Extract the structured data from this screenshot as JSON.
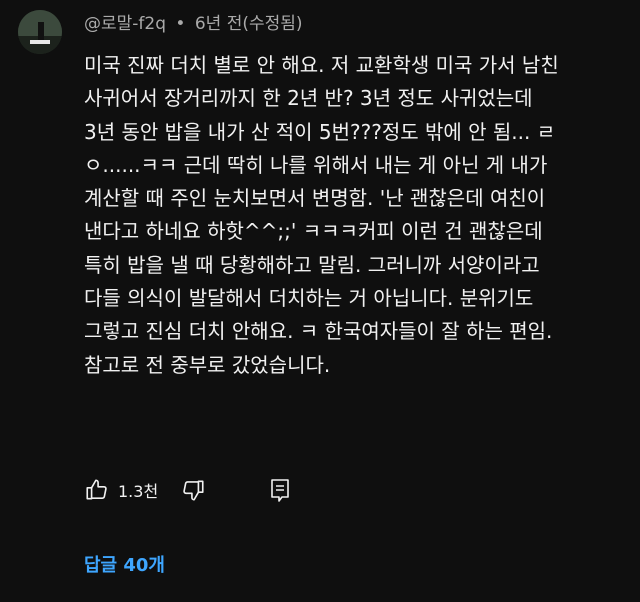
{
  "comment": {
    "author": "@로말-f2q",
    "separator": "•",
    "time": "6년 전(수정됨)",
    "lines": [
      "미국 진짜 더치 별로 안 해요. 저 교환학생 미국 가서 남친",
      "사귀어서 장거리까지 한 2년 반? 3년 정도 사귀었는데",
      "3년 동안 밥을 내가 산 적이 5번???정도 밖에 안 됨... ㄹ",
      "ㅇ......ㅋㅋ 근데 딱히 나를 위해서 내는 게 아닌 게 내가",
      "계산할 때 주인 눈치보면서 변명함. '난 괜찮은데 여친이",
      "낸다고 하네요 하핫^^;;' ㅋㅋㅋ커피 이런 건 괜찮은데",
      "특히 밥을 낼 때 당황해하고 말림.  그러니까 서양이라고",
      "다들 의식이 발달해서 더치하는 거 아닙니다. 분위기도",
      "그렇고 진심 더치 안해요. ㅋ 한국여자들이 잘 하는 편임.",
      "참고로 전 중부로 갔었습니다."
    ],
    "like_count": "1.3천",
    "replies_label": "답글 40개"
  },
  "icons": {
    "like": "thumbs-up-icon",
    "dislike": "thumbs-down-icon",
    "reply": "comment-reply-icon"
  },
  "colors": {
    "background": "#0f0f0f",
    "text": "#f1f1f1",
    "meta": "#aaaaaa",
    "link": "#3ea6ff"
  }
}
